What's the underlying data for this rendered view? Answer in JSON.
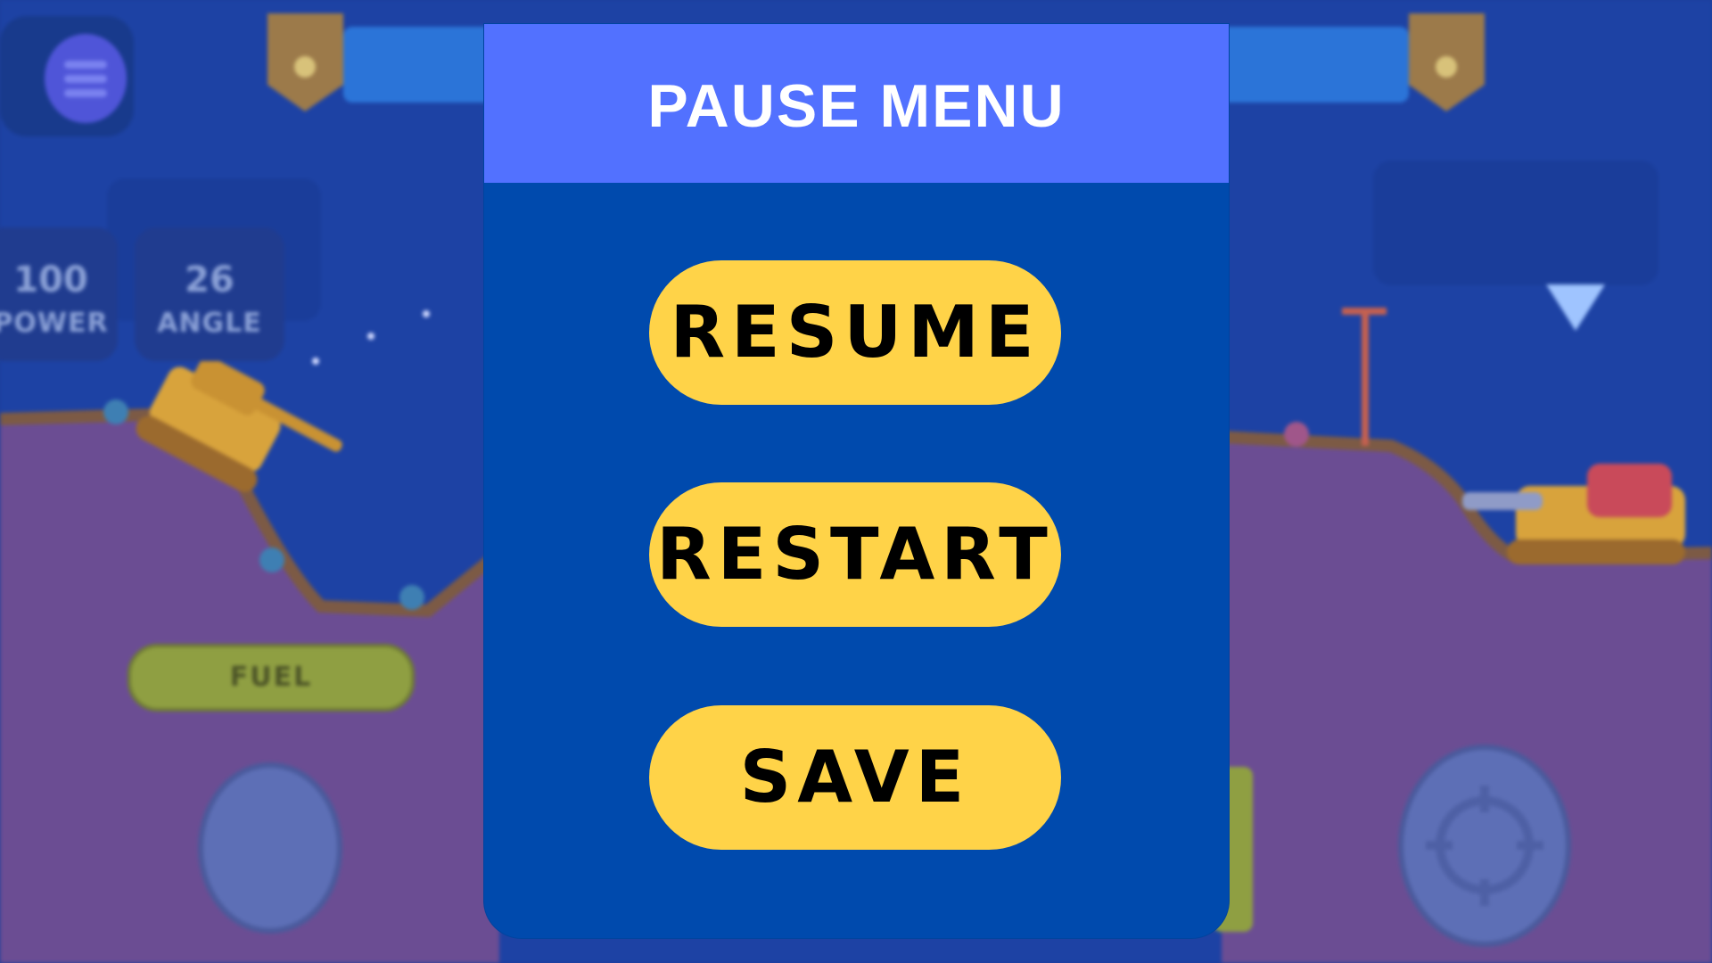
{
  "hud": {
    "menu_icon": "hamburger-menu-icon",
    "power": {
      "value": "100",
      "label": "POWER"
    },
    "angle": {
      "value": "26",
      "label": "ANGLE"
    },
    "fuel_label": "FUEL",
    "turn_indicator_icon": "triangle-down-icon"
  },
  "pause_menu": {
    "title": "PAUSE MENU",
    "buttons": [
      {
        "label": "RESUME"
      },
      {
        "label": "RESTART"
      },
      {
        "label": "SAVE"
      }
    ]
  },
  "colors": {
    "header": "#5271ff",
    "panel": "#004aad",
    "button": "#ffd348",
    "button_text": "#000000",
    "title_text": "#ffffff"
  }
}
